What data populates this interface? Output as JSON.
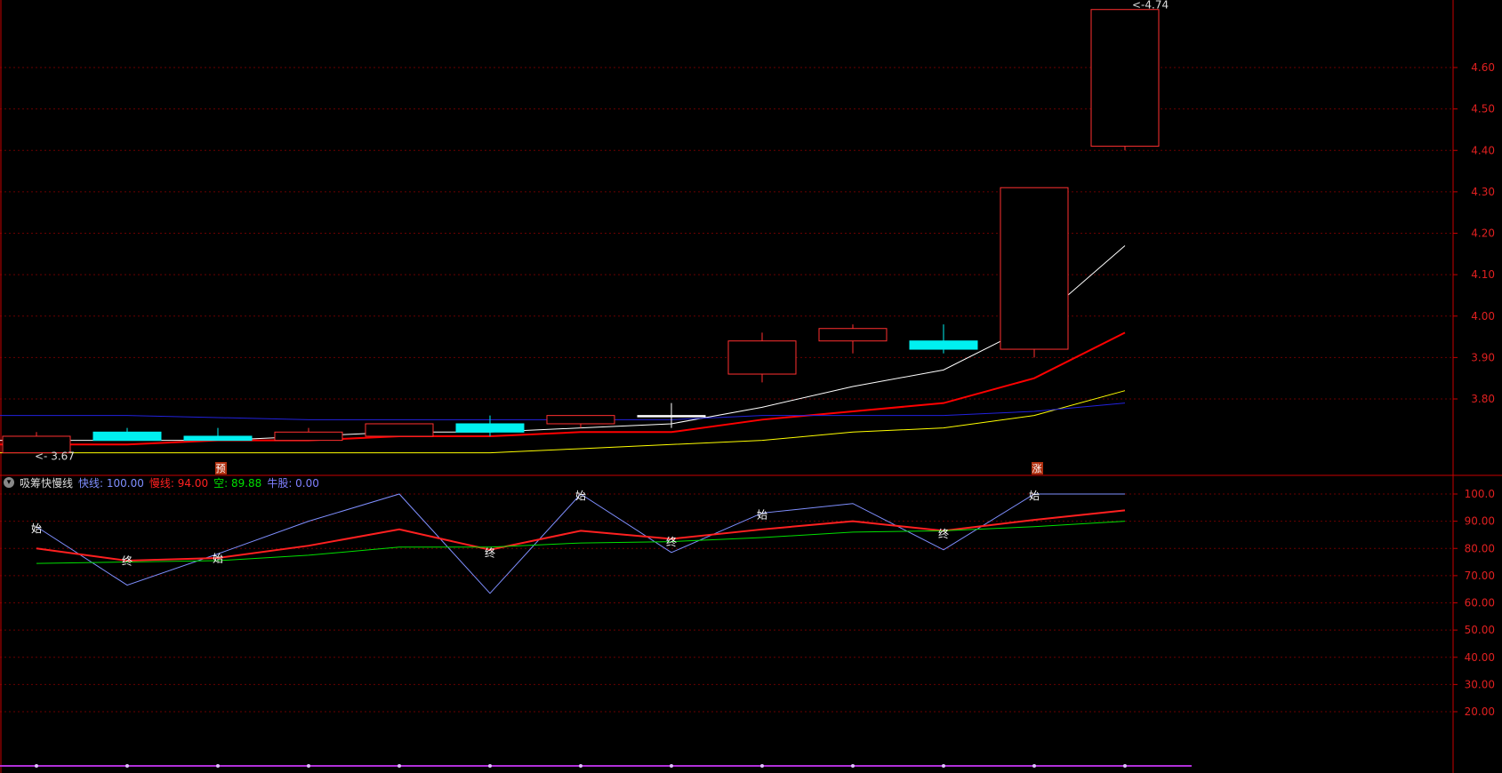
{
  "chart_data": [
    {
      "type": "candlestick",
      "title": "",
      "ylim": [
        3.61,
        4.74
      ],
      "y_ticks": [
        "3.80",
        "3.90",
        "4.00",
        "4.10",
        "4.20",
        "4.30",
        "4.40",
        "4.50",
        "4.60"
      ],
      "grid": true,
      "candles": [
        {
          "open": 3.71,
          "close": 3.67,
          "high": 3.72,
          "low": 3.67,
          "color": "red-hollow"
        },
        {
          "open": 3.72,
          "close": 3.7,
          "high": 3.73,
          "low": 3.7,
          "color": "cyan"
        },
        {
          "open": 3.71,
          "close": 3.7,
          "high": 3.73,
          "low": 3.7,
          "color": "cyan"
        },
        {
          "open": 3.7,
          "close": 3.72,
          "high": 3.73,
          "low": 3.7,
          "color": "red-hollow"
        },
        {
          "open": 3.71,
          "close": 3.74,
          "high": 3.74,
          "low": 3.71,
          "color": "red-hollow"
        },
        {
          "open": 3.74,
          "close": 3.72,
          "high": 3.76,
          "low": 3.71,
          "color": "cyan"
        },
        {
          "open": 3.74,
          "close": 3.76,
          "high": 3.76,
          "low": 3.73,
          "color": "red-hollow"
        },
        {
          "open": 3.76,
          "close": 3.76,
          "high": 3.79,
          "low": 3.73,
          "color": "white"
        },
        {
          "open": 3.86,
          "close": 3.94,
          "high": 3.96,
          "low": 3.84,
          "color": "red-hollow"
        },
        {
          "open": 3.94,
          "close": 3.97,
          "high": 3.98,
          "low": 3.91,
          "color": "red-hollow"
        },
        {
          "open": 3.94,
          "close": 3.92,
          "high": 3.98,
          "low": 3.91,
          "color": "cyan"
        },
        {
          "open": 3.92,
          "close": 4.31,
          "high": 4.31,
          "low": 3.9,
          "color": "red-hollow"
        },
        {
          "open": 4.41,
          "close": 4.74,
          "high": 4.74,
          "low": 4.4,
          "color": "red-hollow"
        }
      ],
      "series": [
        {
          "color": "#ffffff",
          "values": [
            3.7,
            3.7,
            3.7,
            3.71,
            3.72,
            3.72,
            3.73,
            3.74,
            3.78,
            3.83,
            3.87,
            3.98,
            4.17
          ]
        },
        {
          "color": "#ff0000",
          "values": [
            3.69,
            3.69,
            3.7,
            3.7,
            3.71,
            3.71,
            3.72,
            3.72,
            3.75,
            3.77,
            3.79,
            3.85,
            3.96
          ]
        },
        {
          "color": "#ffff00",
          "values": [
            3.67,
            3.67,
            3.67,
            3.67,
            3.67,
            3.67,
            3.68,
            3.69,
            3.7,
            3.72,
            3.73,
            3.76,
            3.82
          ]
        },
        {
          "color": "#2222dd",
          "values": [
            3.76,
            3.76,
            3.755,
            3.75,
            3.75,
            3.75,
            3.75,
            3.75,
            3.76,
            3.76,
            3.76,
            3.77,
            3.79
          ]
        }
      ],
      "annotations": [
        {
          "text": "<- 3.67",
          "index": 0,
          "value": 3.67
        },
        {
          "text": "<-4.74",
          "index": 12,
          "value": 4.74
        },
        {
          "text": "预",
          "index": 2
        },
        {
          "text": "涨",
          "index": 11
        }
      ]
    },
    {
      "type": "line",
      "title": "吸筹快慢线",
      "ylim": [
        0,
        104
      ],
      "y_ticks": [
        "20.00",
        "30.00",
        "40.00",
        "50.00",
        "60.00",
        "70.00",
        "80.00",
        "90.00",
        "100.0"
      ],
      "grid": true,
      "legend": [
        {
          "name": "快线:",
          "value": "100.00",
          "color": "#7f8fff"
        },
        {
          "name": "慢线:",
          "value": "94.00",
          "color": "#ff2020"
        },
        {
          "name": "空:",
          "value": "89.88",
          "color": "#00e000"
        },
        {
          "name": "牛股:",
          "value": "0.00",
          "color": "#8080ff"
        }
      ],
      "series": [
        {
          "name": "快线",
          "color": "#7f8fff",
          "values": [
            88,
            66.5,
            78,
            90,
            100,
            63.5,
            100,
            78.5,
            93,
            96.5,
            79.5,
            100,
            100
          ]
        },
        {
          "name": "慢线",
          "color": "#ff2020",
          "values": [
            80,
            75.5,
            76.5,
            81,
            87,
            79.5,
            86.5,
            83.5,
            87,
            90,
            86.5,
            90.5,
            94
          ]
        },
        {
          "name": "空",
          "color": "#00e000",
          "values": [
            74.5,
            75,
            75.5,
            77.5,
            80.5,
            80.5,
            82,
            82.5,
            84,
            86,
            86.5,
            88,
            90
          ]
        }
      ],
      "annotations": [
        {
          "text": "始",
          "index": 0,
          "value": 88
        },
        {
          "text": "终",
          "index": 1,
          "value": 76
        },
        {
          "text": "始",
          "index": 2,
          "value": 77
        },
        {
          "text": "终",
          "index": 5,
          "value": 79
        },
        {
          "text": "始",
          "index": 6,
          "value": 100
        },
        {
          "text": "终",
          "index": 7,
          "value": 83
        },
        {
          "text": "始",
          "index": 8,
          "value": 93
        },
        {
          "text": "终",
          "index": 10,
          "value": 86
        },
        {
          "text": "始",
          "index": 11,
          "value": 100
        }
      ]
    }
  ],
  "colors": {
    "background": "#000000",
    "grid": "#6a0000",
    "axis": "#c80000",
    "tick_text": "#e02020",
    "up_candle": "#ff3030",
    "down_candle": "#00f0f0",
    "purple_baseline": "#b030d8"
  },
  "panel_toggle_icon": "chevron-down-icon"
}
